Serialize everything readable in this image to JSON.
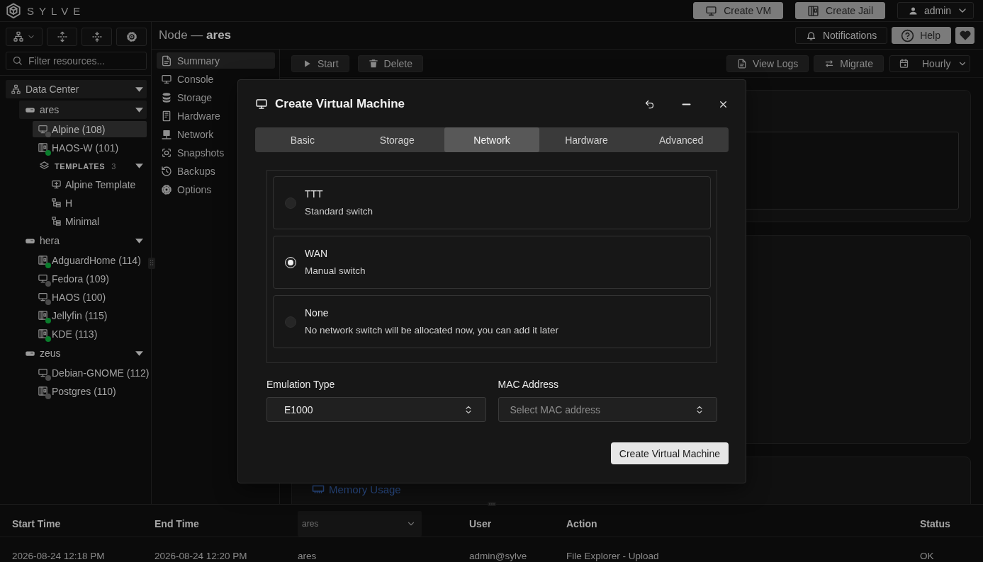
{
  "topbar": {
    "brand": "SYLVE",
    "actions": [
      {
        "label": "Create VM",
        "kind": "vm"
      },
      {
        "label": "Create Jail",
        "kind": "jail"
      }
    ],
    "user": {
      "label": "admin"
    }
  },
  "sidebar": {
    "filter": {
      "placeholder": "Filter resources..."
    },
    "tree": [
      {
        "label": "Data Center",
        "kind": "datacenter",
        "expanded": true,
        "selected": false,
        "children": [
          {
            "label": "ares",
            "kind": "node",
            "expanded": true,
            "selected": false,
            "children": [
              {
                "label": "Alpine (108)",
                "kind": "vm",
                "color": "#4a4a4a",
                "selected": true
              },
              {
                "label": "HAOS-W (101)",
                "kind": "jail",
                "color": "#0a7d2c",
                "selected": false
              },
              {
                "label": "TEMPLATES",
                "count": "3",
                "kind": "templates",
                "expanded": true,
                "selected": false,
                "children": [
                  {
                    "label": "Alpine Template",
                    "kind": "vm-template",
                    "selected": false
                  },
                  {
                    "label": "H",
                    "kind": "jail-template",
                    "selected": false
                  },
                  {
                    "label": "Minimal",
                    "kind": "jail-template",
                    "selected": false
                  }
                ]
              }
            ]
          },
          {
            "label": "hera",
            "kind": "node",
            "expanded": true,
            "selected": false,
            "children": [
              {
                "label": "AdguardHome (114)",
                "kind": "jail",
                "color": "#0a7d2c",
                "selected": false
              },
              {
                "label": "Fedora (109)",
                "kind": "vm",
                "color": "#4a4a4a",
                "selected": false
              },
              {
                "label": "HAOS (100)",
                "kind": "vm",
                "color": "#4a4a4a",
                "selected": false
              },
              {
                "label": "Jellyfin (115)",
                "kind": "jail",
                "color": "#0a7d2c",
                "selected": false
              },
              {
                "label": "KDE (113)",
                "kind": "jail",
                "color": "#0a7d2c",
                "selected": false
              }
            ]
          },
          {
            "label": "zeus",
            "kind": "node",
            "expanded": true,
            "selected": false,
            "children": [
              {
                "label": "Debian-GNOME (112)",
                "kind": "vm",
                "color": "#4a4a4a",
                "selected": false
              },
              {
                "label": "Postgres (110)",
                "kind": "jail",
                "color": "#4a4a4a",
                "selected": false
              }
            ]
          }
        ]
      }
    ]
  },
  "header": {
    "title": "Node — **ares**",
    "actions": [
      {
        "label": "Notifications",
        "kind": "notifications"
      },
      {
        "label": "Help",
        "kind": "help"
      },
      {
        "kind": "favorite"
      }
    ]
  },
  "nav": [
    {
      "label": "Summary",
      "selected": true
    },
    {
      "label": "Console",
      "selected": false
    },
    {
      "label": "Storage",
      "selected": false
    },
    {
      "label": "Hardware",
      "selected": false
    },
    {
      "label": "Network",
      "selected": false
    },
    {
      "label": "Snapshots",
      "selected": false
    },
    {
      "label": "Backups",
      "selected": false
    },
    {
      "label": "Options",
      "selected": false
    }
  ],
  "toolbar": {
    "actions": [
      {
        "label": "Start",
        "kind": "start"
      },
      {
        "label": "Delete",
        "kind": "delete"
      }
    ],
    "tools": [
      {
        "label": "View Logs",
        "kind": "logs"
      },
      {
        "label": "Migrate",
        "kind": "migrate"
      }
    ],
    "interval": {
      "value": "Hourly"
    }
  },
  "memory_card": {
    "title": "Memory Usage"
  },
  "dialog": {
    "title": "Create Virtual Machine",
    "tabs": [
      {
        "label": "Basic",
        "selected": false
      },
      {
        "label": "Storage",
        "selected": false
      },
      {
        "label": "Network",
        "selected": true
      },
      {
        "label": "Hardware",
        "selected": false
      },
      {
        "label": "Advanced",
        "selected": false
      }
    ],
    "switches": [
      {
        "name": "TTT",
        "description": "Standard switch",
        "selected": false
      },
      {
        "name": "WAN",
        "description": "Manual switch",
        "selected": true
      },
      {
        "name": "None",
        "description": "No network switch will be allocated now, you can add it later",
        "selected": false
      }
    ],
    "emulation_type": {
      "label": "Emulation Type",
      "value": "E1000"
    },
    "mac_address": {
      "label": "MAC Address",
      "placeholder": "Select MAC address"
    },
    "submit": "Create Virtual Machine"
  },
  "audit_log": {
    "columns": [
      {
        "kind": "text",
        "label": "Start Time"
      },
      {
        "kind": "text",
        "label": "End Time"
      },
      {
        "kind": "filter",
        "value": "ares"
      },
      {
        "kind": "text",
        "label": "User"
      },
      {
        "kind": "text",
        "label": "Action"
      },
      {
        "kind": "text",
        "label": "Status"
      }
    ],
    "rows": [
      [
        "2026-08-24 12:18 PM",
        "2026-08-24 12:20 PM",
        "ares",
        "admin@sylve",
        "File Explorer - Upload",
        "OK"
      ]
    ]
  }
}
